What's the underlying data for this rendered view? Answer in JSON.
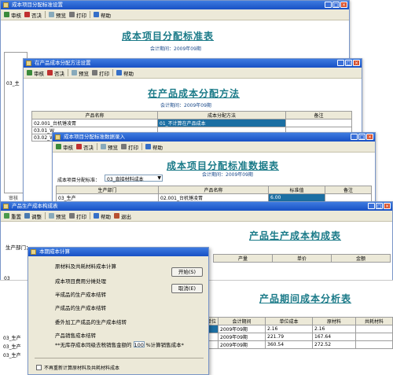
{
  "w1": {
    "title": "成本项目分配标准设置",
    "tools": [
      "审核",
      "否决",
      "预览",
      "打印",
      "帮助"
    ],
    "report_title": "成本项目分配标准表",
    "period": "会计期间：2009年09期",
    "side_label": "03_主",
    "bottom_label": "审核"
  },
  "w2": {
    "title": "在产品成本分配方法设置",
    "tools": [
      "审核",
      "否决",
      "预览",
      "打印",
      "帮助"
    ],
    "report_title": "在产品成本分配方法",
    "period": "会计期间：2009年09期",
    "headers": [
      "产品名称",
      "成本分配方法",
      "备注"
    ],
    "rows": [
      [
        "02.001_台机锤凌胃",
        "01_不计算在产品成本",
        ""
      ],
      [
        "03.01_W",
        "",
        ""
      ],
      [
        "03.02_W",
        "",
        ""
      ]
    ]
  },
  "w3": {
    "title": "成本项目分配标准数据录入",
    "tools": [
      "审核",
      "否决",
      "预览",
      "打印",
      "帮助"
    ],
    "report_title": "成本项目分配标准数据表",
    "period": "会计期间：2009年09期",
    "cost_item_label": "成本项目分配标准：",
    "cost_item_value": "03_直接材料成本",
    "headers": [
      "生产部门",
      "产品名称",
      "标准值",
      "备注"
    ],
    "rows": [
      [
        "03_生产",
        "02.001_台机锤凌胃",
        "6.00",
        ""
      ]
    ]
  },
  "w4": {
    "title": "产品生产成本构成表",
    "tools": [
      "重置",
      "调整",
      "预览",
      "打印",
      "帮助",
      "退出"
    ],
    "report_title": "产品生产成本构成表",
    "dept_label": "生产部门：",
    "headers": [
      "产量",
      "单价",
      "金额"
    ],
    "side": [
      "03",
      "03",
      "03_生",
      "03_生"
    ]
  },
  "w5": {
    "report_title": "产品期间成本分析表",
    "headers": [
      "量单位",
      "会计期间",
      "单位成本",
      "原材料",
      "共耗材料"
    ],
    "side_rows": [
      "03_生产",
      "03_生产",
      "03_生产"
    ],
    "rows": [
      [
        "个",
        "2009年09期",
        "2.16",
        "2.16",
        ""
      ],
      [
        "台",
        "2009年09期",
        "221.79",
        "167.64",
        ""
      ],
      [
        "台",
        "2009年09期",
        "360.54",
        "272.52",
        ""
      ]
    ]
  },
  "dlg": {
    "title": "本期成本计算",
    "steps": [
      "原材料及共耗材料成本计算",
      "成本项目费用分摊处理",
      "半成品的生产成本结转",
      "产成品的生产成本结转",
      "委外加工产成品的生产成本结转",
      "产品销售成本结转"
    ],
    "note_prefix": "**无库存成本同级去税销售金额的",
    "note_value": "100",
    "note_suffix": "%计算销售成本*",
    "start": "开始(S)",
    "cancel": "取消(E)",
    "checkbox_label": "不再重新计算原材料及共耗材料成本"
  }
}
